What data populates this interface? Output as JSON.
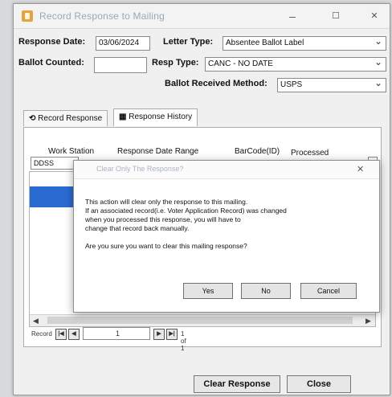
{
  "window": {
    "title": "Record Response to Mailing",
    "minimize_glyph": "–",
    "maximize_glyph": "☐",
    "close_glyph": "✕"
  },
  "form": {
    "response_date_label": "Response Date:",
    "response_date_value": "03/06/2024",
    "letter_type_label": "Letter Type:",
    "letter_type_value": "Absentee Ballot Label",
    "ballot_counted_label": "Ballot Counted:",
    "ballot_counted_value": "",
    "resp_type_label": "Resp Type:",
    "resp_type_value": "CANC - NO DATE",
    "ballot_received_method_label": "Ballot Received Method:",
    "ballot_received_method_value": "USPS"
  },
  "tabs": [
    {
      "label": "Record Response",
      "icon": "record-icon"
    },
    {
      "label": "Response History",
      "icon": "grid-icon"
    }
  ],
  "grid": {
    "headers": [
      "Work Station",
      "Response Date Range",
      "BarCode(ID)",
      "Processed"
    ],
    "filter_partial": "DDSS"
  },
  "pager": {
    "label": "Record",
    "first_glyph": "|◀",
    "prev_glyph": "◀",
    "current": "1",
    "next_glyph": "▶",
    "last_glyph": "▶|",
    "of_text": "1 of 1"
  },
  "buttons": {
    "clear_response": "Clear Response",
    "close": "Close"
  },
  "dialog": {
    "title": "Clear Only The Response?",
    "close_glyph": "✕",
    "message": "This action will clear only the response to this mailing.\nIf an associated record(i.e. Voter Application Record) was changed\nwhen you processed this response, you will have to\nchange that record back manually.\n\nAre you sure you want to clear this mailing response?",
    "yes": "Yes",
    "no": "No",
    "cancel": "Cancel"
  },
  "colors": {
    "selection": "#2a6bd2",
    "window_bg": "#f0f0f0"
  }
}
